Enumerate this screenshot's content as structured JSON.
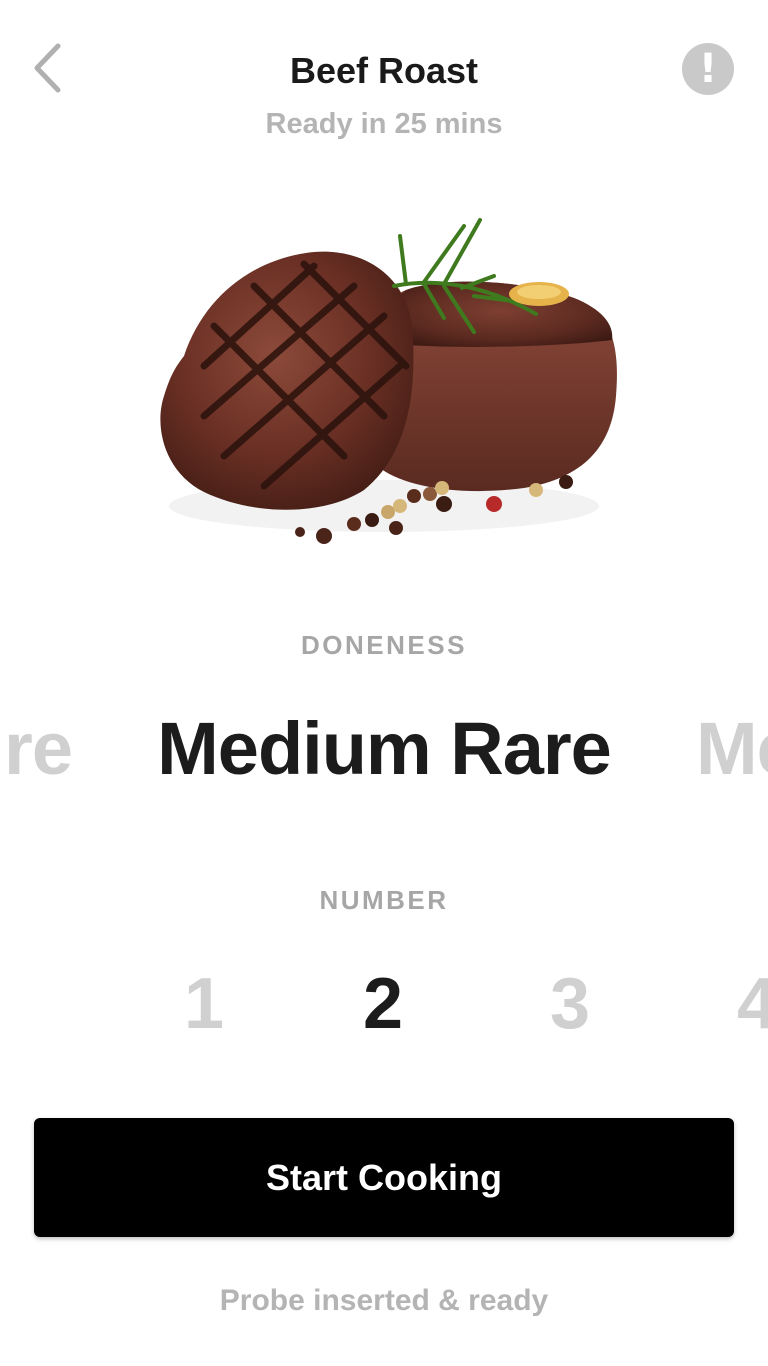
{
  "header": {
    "title": "Beef Roast",
    "subtitle": "Ready in 25 mins",
    "back_icon": "chevron-left-icon",
    "info_icon": "exclamation-circle-icon",
    "info_glyph": "!"
  },
  "photo": {
    "subject": "grilled-steak-image"
  },
  "doneness": {
    "label": "DONENESS",
    "previous_fragment": "re",
    "selected": "Medium Rare",
    "next_fragment": "Me"
  },
  "number": {
    "label": "NUMBER",
    "options": [
      "1",
      "2",
      "3",
      "4"
    ],
    "selected": "2"
  },
  "action": {
    "start_label": "Start Cooking"
  },
  "status": {
    "text": "Probe inserted & ready"
  },
  "colors": {
    "primary_text": "#1c1c1c",
    "muted_text": "#b4b4b4",
    "inactive_option": "#d0d0d0",
    "button_bg": "#000000",
    "button_text": "#ffffff",
    "info_icon_bg": "#c9c9c9"
  }
}
